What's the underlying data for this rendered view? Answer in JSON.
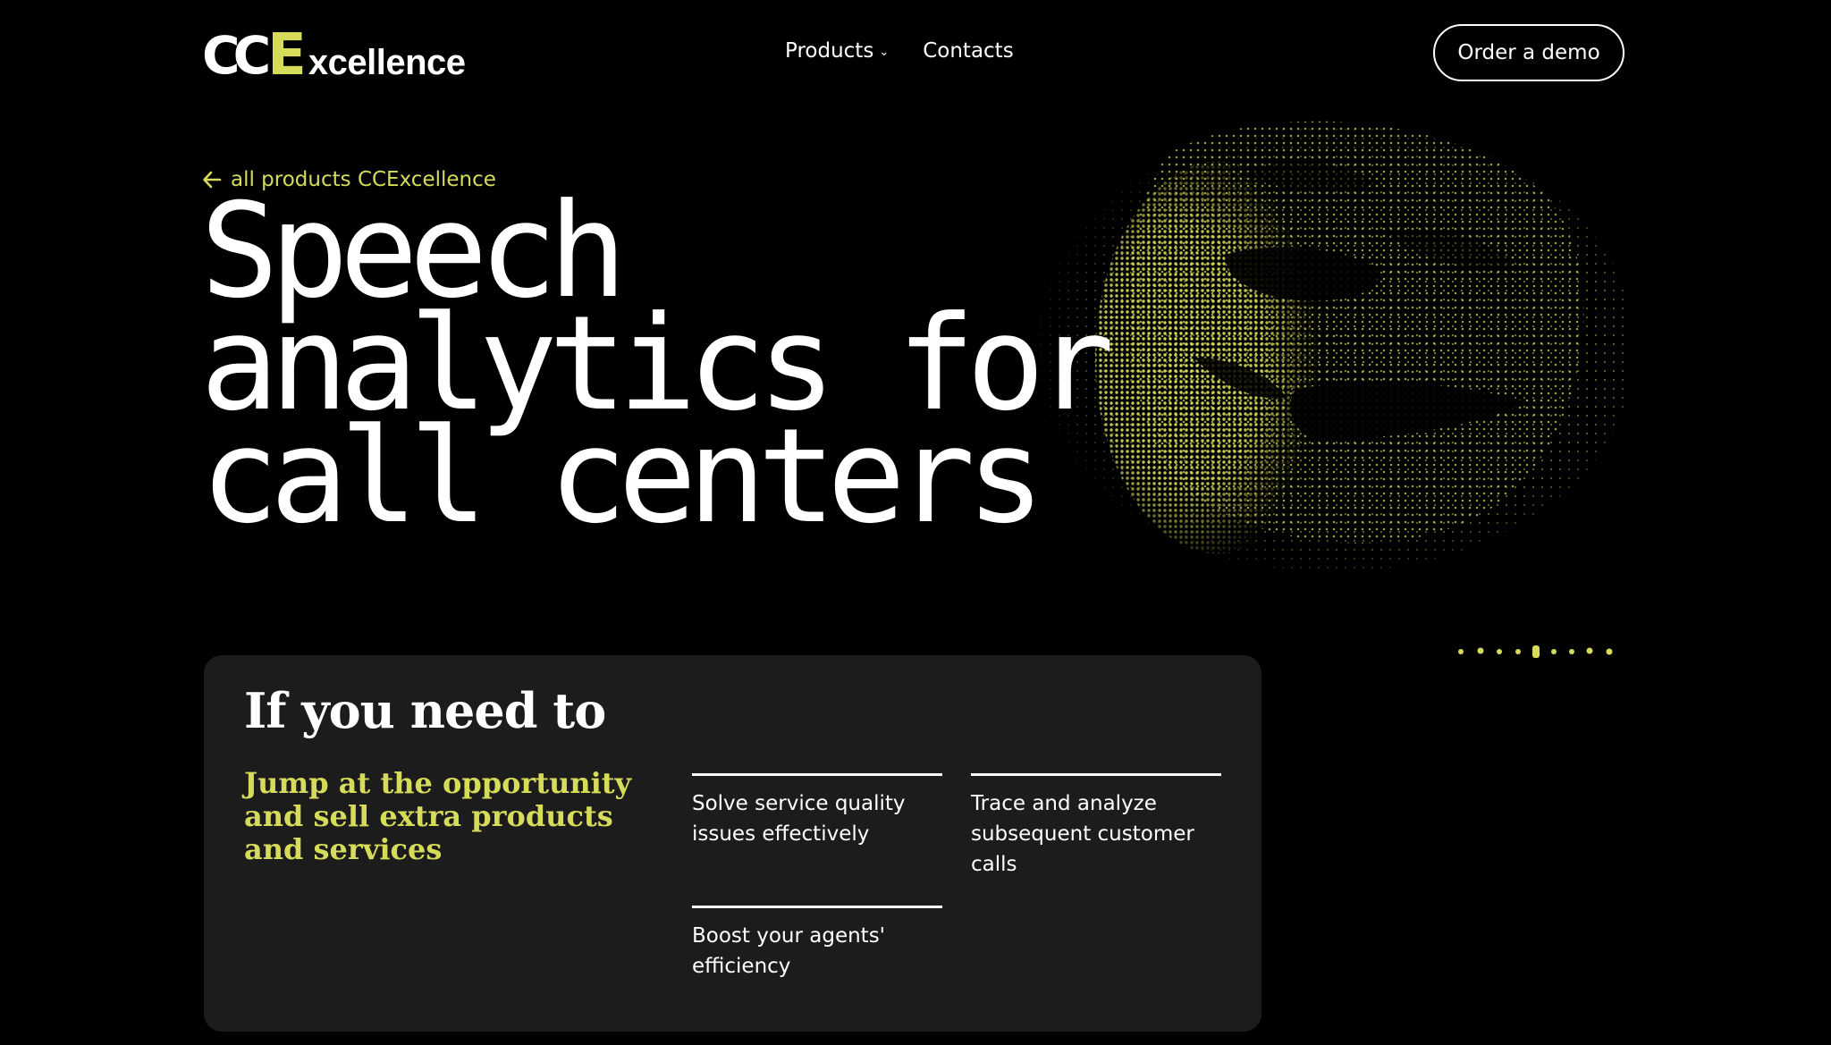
{
  "colors": {
    "background": "#000000",
    "accent": "#d6db5a",
    "card": "#1c1c1c",
    "text": "#ffffff"
  },
  "header": {
    "logo": {
      "mark": "CC",
      "letter": "E",
      "word": "xcellence"
    },
    "nav": [
      {
        "label": "Products",
        "has_dropdown": true,
        "icon": "chevron-down-icon"
      },
      {
        "label": "Contacts"
      }
    ],
    "cta_label": "Order a demo"
  },
  "back_link": {
    "label": "all products CCExcellence",
    "icon": "arrow-left-icon"
  },
  "hero": {
    "title_lines": [
      "Speech",
      "analytics for",
      "call centers"
    ],
    "art": "dotted-face-illustration"
  },
  "card": {
    "title": "If you need to",
    "lead": "Jump at the opportunity and sell extra products and services",
    "items": [
      "Solve service quality issues effectively",
      "Trace and analyze subsequent customer calls",
      "Boost your agents' efficiency"
    ]
  }
}
